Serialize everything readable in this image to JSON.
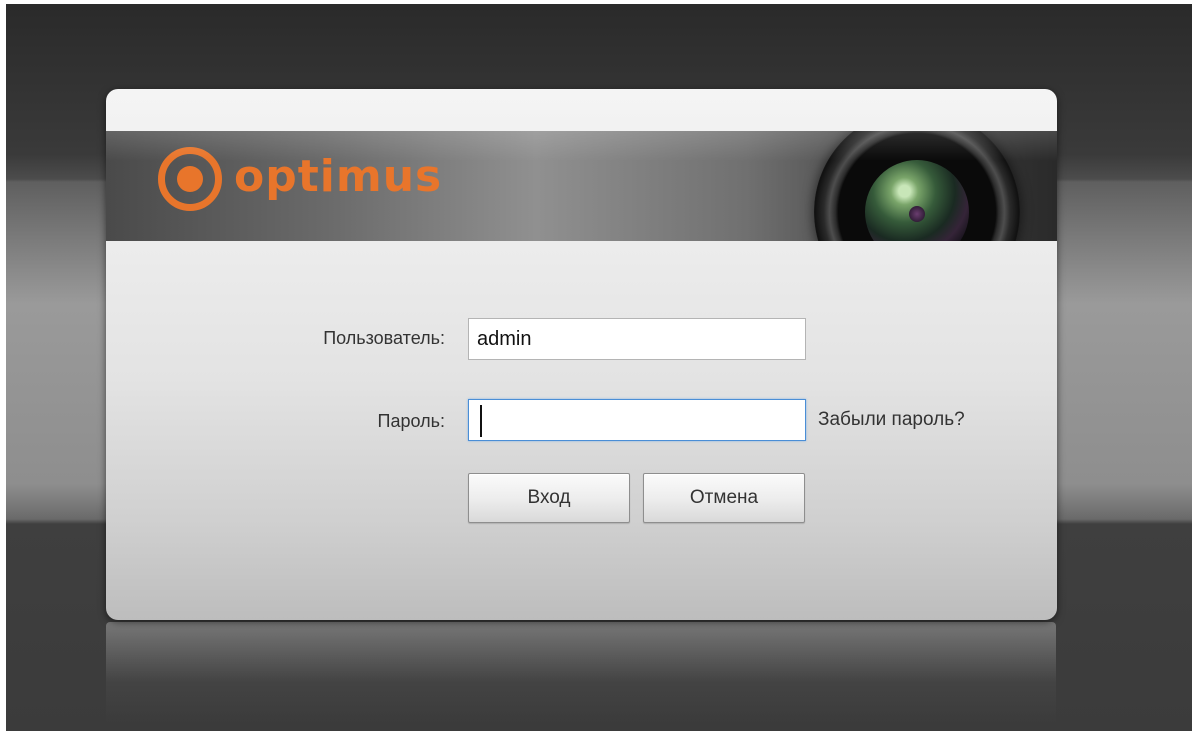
{
  "brand": {
    "name": "optimus",
    "color": "#e8752b"
  },
  "login": {
    "username_label": "Пользователь:",
    "username_value": "admin",
    "password_label": "Пароль:",
    "password_value": "",
    "forgot_password": "Забыли пароль?",
    "login_button": "Вход",
    "cancel_button": "Отмена"
  },
  "icons": {
    "logo": "optimus-logo-icon",
    "banner_image": "camera-lens-icon"
  },
  "colors": {
    "accent": "#e8752b",
    "focus_border": "#4a8ed6"
  }
}
